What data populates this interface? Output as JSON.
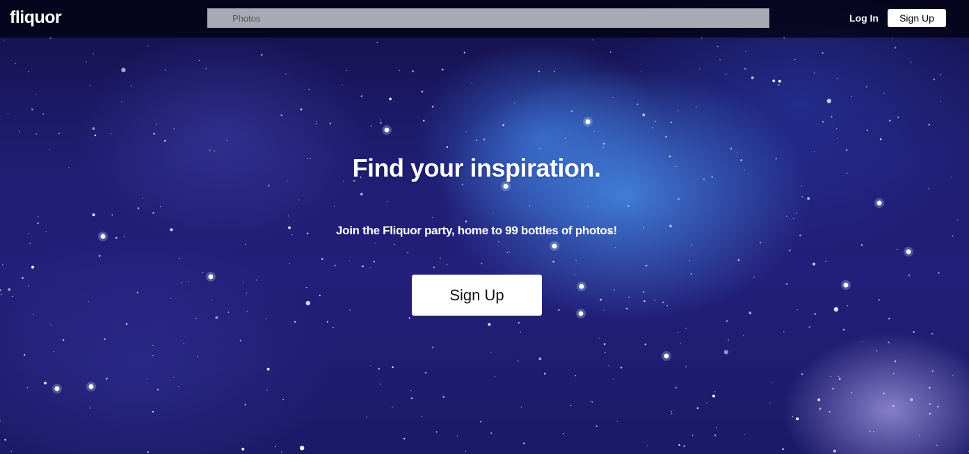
{
  "header": {
    "logo": "fliquor",
    "search_placeholder": "Photos",
    "login_label": "Log In",
    "signup_label": "Sign Up"
  },
  "hero": {
    "title": "Find your inspiration.",
    "subtitle": "Join the Fliquor party, home to 99 bottles of photos!",
    "signup_label": "Sign Up"
  },
  "colors": {
    "background_deep": "#1f1d72",
    "nebula_blue": "#468ce6",
    "button_bg": "#ffffff",
    "text": "#ffffff"
  }
}
